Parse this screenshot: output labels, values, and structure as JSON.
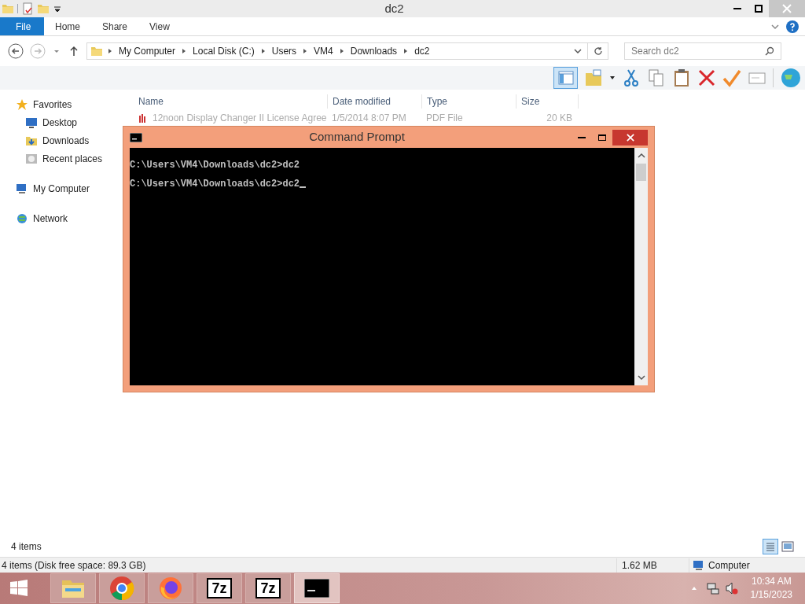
{
  "window": {
    "title": "dc2"
  },
  "ribbon_tabs": [
    {
      "label": "File",
      "kind": "file"
    },
    {
      "label": "Home",
      "kind": "tab"
    },
    {
      "label": "Share",
      "kind": "tab"
    },
    {
      "label": "View",
      "kind": "tab"
    }
  ],
  "address": {
    "breadcrumbs": [
      "My Computer",
      "Local Disk (C:)",
      "Users",
      "VM4",
      "Downloads",
      "dc2"
    ],
    "search_placeholder": "Search dc2"
  },
  "toolbar": {
    "layout_pane_on": true
  },
  "sidebar": [
    {
      "label": "Favorites",
      "kind": "star",
      "children": [
        {
          "label": "Desktop",
          "kind": "desktop"
        },
        {
          "label": "Downloads",
          "kind": "downloads"
        },
        {
          "label": "Recent places",
          "kind": "recent"
        }
      ]
    },
    {
      "label": "My Computer",
      "kind": "computer"
    },
    {
      "label": "Network",
      "kind": "network"
    }
  ],
  "table": {
    "columns": [
      "Name",
      "Date modified",
      "Type",
      "Size"
    ],
    "rows": [
      {
        "name": "12noon Display Changer II License Agree",
        "date": "1/5/2014 8:07 PM",
        "type": "PDF File",
        "size": "20 KB"
      }
    ]
  },
  "cmd": {
    "title": "Command Prompt",
    "lines": [
      "C:\\Users\\VM4\\Downloads\\dc2>dc2",
      "C:\\Users\\VM4\\Downloads\\dc2>dc2"
    ],
    "cursor": true
  },
  "item_count": "4 items",
  "status_bar": {
    "left": "4 items (Disk free space: 89.3 GB)",
    "size": "1.62 MB",
    "location": "Computer"
  },
  "taskbar": {
    "items": [
      {
        "kind": "explorer",
        "active": false
      },
      {
        "kind": "chrome",
        "active": false
      },
      {
        "kind": "firefox",
        "active": false
      },
      {
        "kind": "sevenzip",
        "label": "7z",
        "active": false
      },
      {
        "kind": "sevenzip",
        "label": "7z",
        "active": false
      },
      {
        "kind": "cmd",
        "active": true
      }
    ],
    "time": "10:34 AM",
    "date": "1/15/2023"
  }
}
